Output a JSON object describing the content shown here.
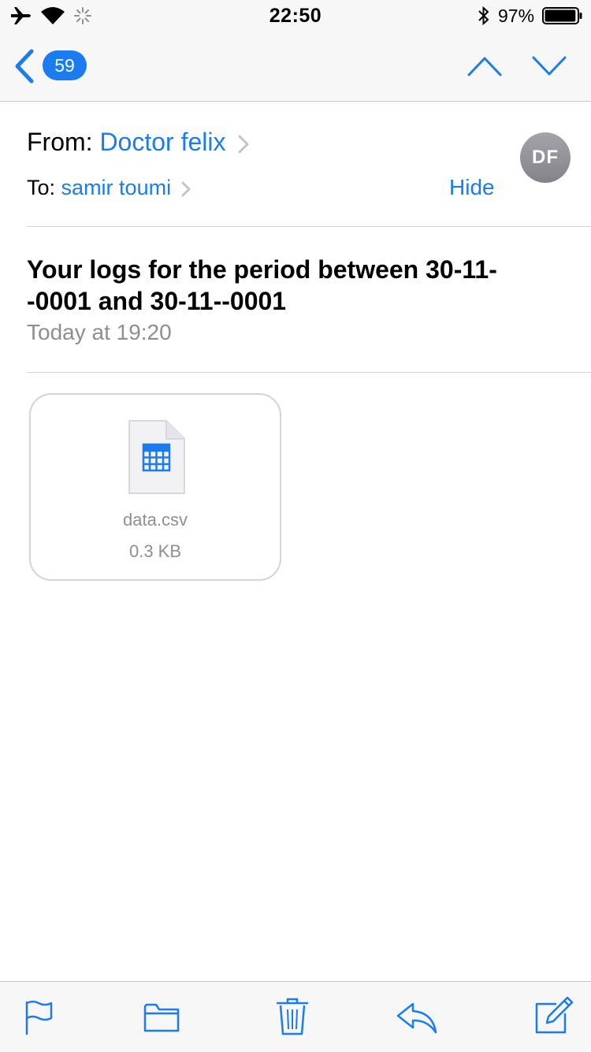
{
  "status_bar": {
    "time": "22:50",
    "battery_percent": "97%",
    "battery_level": 0.97,
    "icons": [
      "airplane-icon",
      "wifi-icon",
      "activity-spinner-icon",
      "bluetooth-icon",
      "battery-icon"
    ]
  },
  "nav": {
    "back_icon": "chevron-left-icon",
    "unread_count": "59",
    "prev_icon": "chevron-up-icon",
    "next_icon": "chevron-down-icon"
  },
  "header": {
    "from_label": "From:",
    "from_name": "Doctor felix",
    "to_label": "To:",
    "to_name": "samir toumi",
    "hide_label": "Hide",
    "avatar_initials": "DF"
  },
  "message": {
    "subject": "Your logs for the period between 30-11--0001 and 30-11--0001",
    "date": "Today at 19:20"
  },
  "attachment": {
    "icon": "spreadsheet-file-icon",
    "name": "data.csv",
    "size": "0.3 KB"
  },
  "toolbar": {
    "icons": [
      "flag-icon",
      "folder-icon",
      "trash-icon",
      "reply-icon",
      "compose-icon"
    ]
  },
  "colors": {
    "accent": "#1a7cf0",
    "secondary_text": "#8e8e93",
    "bar_background": "#f7f7f7"
  }
}
